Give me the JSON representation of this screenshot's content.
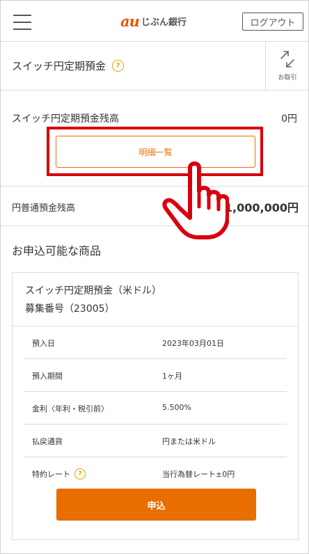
{
  "header": {
    "logo_mark": "au",
    "logo_text": "じぶん銀行",
    "logout_label": "ログアウト"
  },
  "product_header": {
    "title": "スイッチ円定期預金",
    "help_symbol": "?",
    "transaction_label": "お取引"
  },
  "balance": {
    "label": "スイッチ円定期預金残高",
    "value": "0円",
    "detail_button": "明細一覧"
  },
  "yen_balance": {
    "label": "円普通預金残高",
    "value": "1,000,000円"
  },
  "available": {
    "section_title": "お申込可能な商品",
    "product_name": "スイッチ円定期預金（米ドル）",
    "product_no": "募集番号（23005）",
    "rows": [
      {
        "key": "預入日",
        "value": "2023年03月01日"
      },
      {
        "key": "預入期間",
        "value": "1ヶ月"
      },
      {
        "key": "金利〈年利・税引前〉",
        "value": "5.500%"
      },
      {
        "key": "払戻通貨",
        "value": "円または米ドル"
      },
      {
        "key": "特約レート",
        "value": "当行為替レート±0円"
      }
    ],
    "apply_button": "申込"
  },
  "colors": {
    "accent_orange": "#e86e00",
    "highlight_red": "#d9000d",
    "help_yellow": "#f0a000"
  }
}
